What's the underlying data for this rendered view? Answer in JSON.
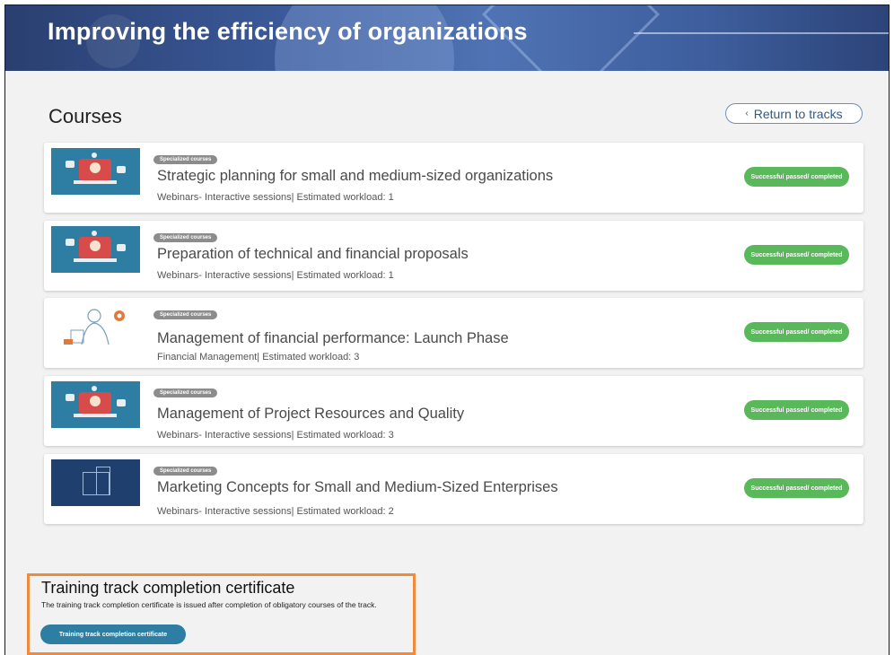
{
  "header": {
    "title": "Improving the efficiency of organizations"
  },
  "courses_section": {
    "heading": "Courses",
    "return_label": "Return to tracks"
  },
  "courses": [
    {
      "tag": "Specialized courses",
      "title": "Strategic planning  for small and medium-sized organizations",
      "meta": "Webinars- Interactive sessions| Estimated workload: 1",
      "status": "Successful passed/ completed",
      "thumb": "webinar"
    },
    {
      "tag": "Specialized courses",
      "title": "Preparation of technical and financial proposals",
      "meta": "Webinars- Interactive sessions| Estimated workload: 1",
      "status": "Successful passed/ completed",
      "thumb": "webinar"
    },
    {
      "tag": "Specialized courses",
      "title": "Management of financial performance: Launch Phase",
      "meta": "Financial Management| Estimated workload: 3",
      "status": "Successful passed/ completed",
      "thumb": "sketch"
    },
    {
      "tag": "Specialized courses",
      "title": "Management of Project Resources and Quality",
      "meta": "Webinars- Interactive sessions| Estimated workload: 3",
      "status": "Successful passed/ completed",
      "thumb": "webinar"
    },
    {
      "tag": "Specialized courses",
      "title": "Marketing Concepts for Small and Medium-Sized Enterprises",
      "meta": "Webinars- Interactive sessions| Estimated workload: 2",
      "status": "Successful passed/ completed",
      "thumb": "buildings"
    }
  ],
  "certificate": {
    "title": "Training track completion certificate",
    "description": "The training track completion certificate is issued after completion of obligatory courses of the track.",
    "button_label": "Training track completion certificate"
  },
  "colors": {
    "status_green": "#58b85a",
    "accent_teal": "#2e7ea3",
    "highlight_orange": "#f08a3c"
  }
}
